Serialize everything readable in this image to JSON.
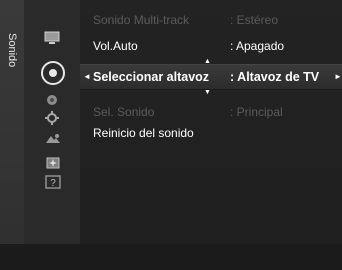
{
  "sidebar": {
    "title": "Sonido"
  },
  "menu": {
    "rows": [
      {
        "label": "Sonido Multi-track",
        "value": ": Estéreo",
        "state": "disabled"
      },
      {
        "label": "Vol.Auto",
        "value": ": Apagado",
        "state": "normal"
      },
      {
        "label": "Seleccionar altavoz",
        "value": ": Altavoz de TV",
        "state": "selected"
      },
      {
        "label": "Sel. Sonido",
        "value": ": Principal",
        "state": "disabled"
      },
      {
        "label": "Reinicio del sonido",
        "value": "",
        "state": "normal"
      }
    ]
  },
  "icons": [
    "tv-picture-icon",
    "sound-icon",
    "channel-icon",
    "settings-gear-icon",
    "input-icon",
    "application-icon",
    "support-help-icon"
  ],
  "colors": {
    "background": "#2b2b2b",
    "text": "#ffffff",
    "disabled_text": "#5b5b5b"
  }
}
